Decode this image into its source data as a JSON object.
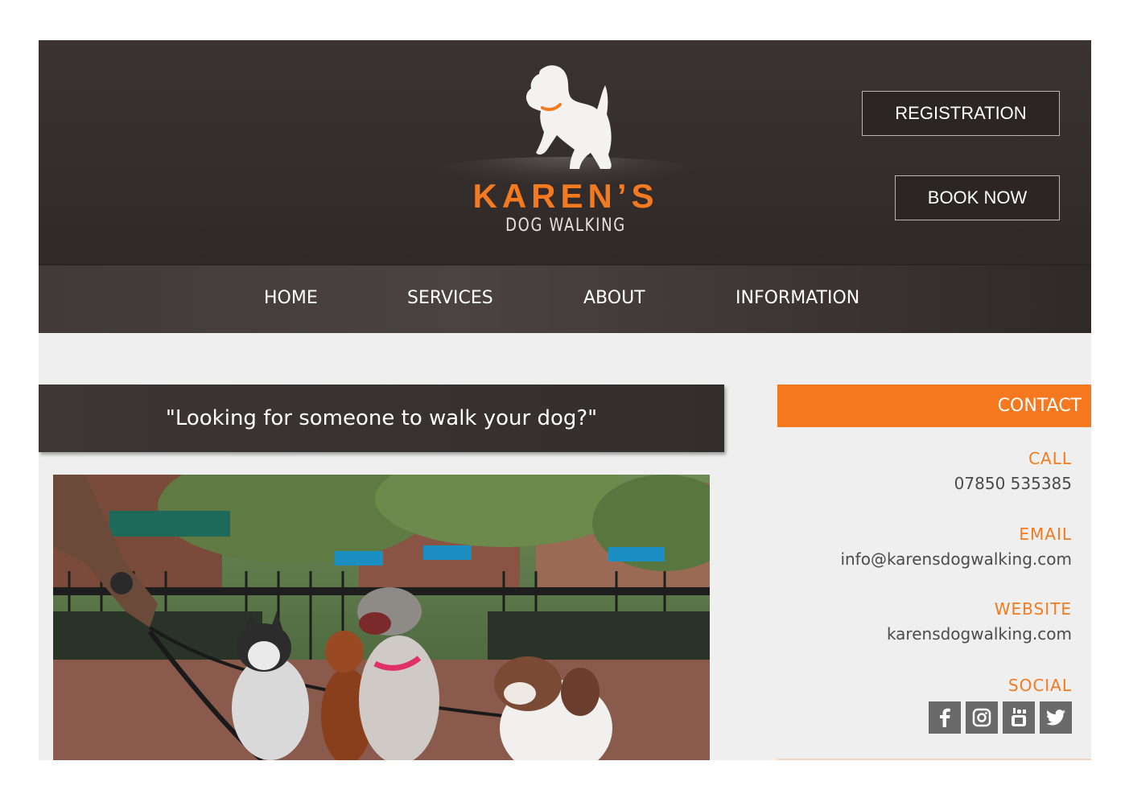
{
  "header": {
    "brand_name": "KAREN’S",
    "brand_sub": "DOG WALKING",
    "registration_label": "REGISTRATION",
    "book_now_label": "BOOK NOW"
  },
  "nav": {
    "items": [
      {
        "label": "HOME"
      },
      {
        "label": "SERVICES"
      },
      {
        "label": "ABOUT"
      },
      {
        "label": "INFORMATION"
      }
    ]
  },
  "main": {
    "banner_text": "\"Looking for someone to walk your dog?\""
  },
  "contact": {
    "title": "CONTACT",
    "call_label": "CALL",
    "call_value": "07850 535385",
    "email_label": "EMAIL",
    "email_value": "info@karensdogwalking.com",
    "website_label": "WEBSITE",
    "website_value": "karensdogwalking.com",
    "social_label": "SOCIAL",
    "social_icons": [
      "facebook-icon",
      "instagram-icon",
      "youtube-icon",
      "twitter-icon"
    ]
  },
  "colors": {
    "accent": "#f5781e",
    "header_bg": "#342e2d",
    "page_bg": "#efefef"
  }
}
